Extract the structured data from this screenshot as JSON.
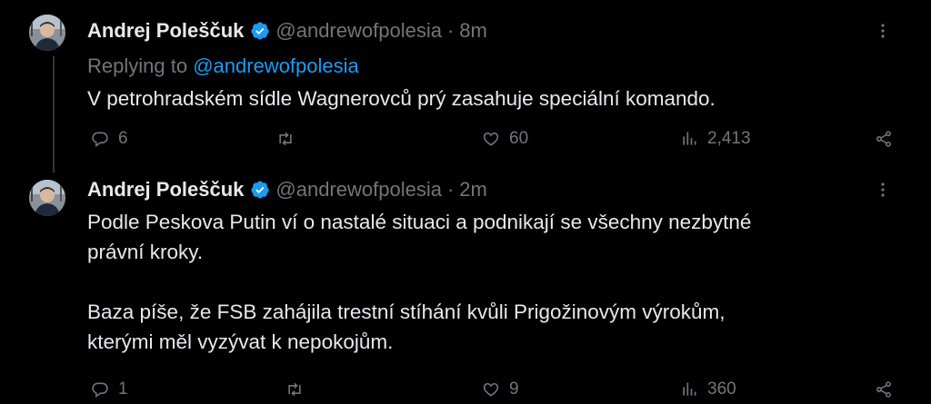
{
  "tweets": [
    {
      "name": "Andrej Poleščuk",
      "handle": "@andrewofpolesia",
      "separator": "·",
      "time": "8m",
      "replying_prefix": "Replying to",
      "replying_handle": "@andrewofpolesia",
      "text": "V petrohradském sídle Wagnerovců prý zasahuje speciální komando.",
      "replies": "6",
      "retweets": "",
      "likes": "60",
      "views": "2,413"
    },
    {
      "name": "Andrej Poleščuk",
      "handle": "@andrewofpolesia",
      "separator": "·",
      "time": "2m",
      "text_p1_l1": "Podle Peskova Putin ví o nastalé situaci a podnikají se všechny nezbytné",
      "text_p1_l2": "právní kroky.",
      "text_p2_l1": "Baza píše, že FSB zahájila trestní stíhání kvůli Prigožinovým výrokům,",
      "text_p2_l2": "kterými měl vyzývat k nepokojům.",
      "replies": "1",
      "retweets": "",
      "likes": "9",
      "views": "360"
    }
  ],
  "colors": {
    "background": "#000000",
    "text": "#e7e9ea",
    "muted": "#71767b",
    "accent": "#1d9bf0"
  },
  "icons": [
    "verified-badge-icon",
    "more-icon",
    "reply-icon",
    "retweet-icon",
    "like-icon",
    "views-icon",
    "share-icon"
  ]
}
